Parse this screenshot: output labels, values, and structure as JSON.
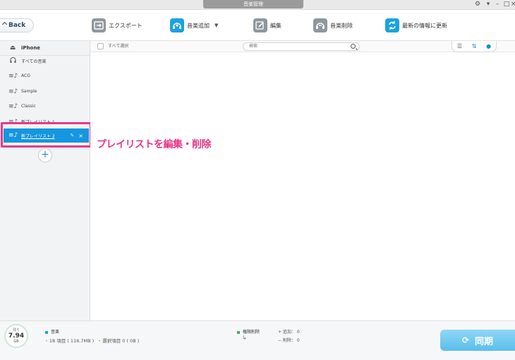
{
  "window": {
    "title": "音楽管理"
  },
  "toolbar": {
    "back_label": "Back",
    "export_label": "エクスポート",
    "add_music_label": "音楽追加",
    "edit_label": "編集",
    "delete_music_label": "音楽削除",
    "refresh_label": "最新の情報に更新"
  },
  "sidebar": {
    "device": "iPhone",
    "items": [
      {
        "label": "すべての音楽",
        "icon": "headphones-icon"
      },
      {
        "label": "ACG",
        "icon": "playlist-icon"
      },
      {
        "label": "Sample",
        "icon": "playlist-icon"
      },
      {
        "label": "Classic",
        "icon": "playlist-icon"
      },
      {
        "label": "新プレイリスト 1",
        "icon": "playlist-icon"
      }
    ],
    "selected": {
      "label": "新プレイリスト 2",
      "icon": "playlist-icon"
    }
  },
  "content": {
    "select_all_label": "すべて選択",
    "search_placeholder": "検索"
  },
  "annotation": {
    "callout_text": "プレイリストを編集・削除",
    "color": "#e8378a"
  },
  "footer": {
    "storage_label": "残り",
    "storage_value": "7.94",
    "storage_unit": "GB",
    "music_label": "音楽",
    "music_summary": "18 項目 ( 116.7MB )",
    "selected_summary": "選択項目 0 ( 0B )",
    "permission_delete_label": "権限削除",
    "added_label": "追加： 0",
    "deleted_label": "削除： 0",
    "sync_label": "同期"
  },
  "colors": {
    "accent_blue": "#1596e0",
    "highlight_pink": "#e8378a",
    "music_square": "#1aa3e0",
    "permission_square": "#3cb55a",
    "selected_dot": "#f0a020"
  }
}
